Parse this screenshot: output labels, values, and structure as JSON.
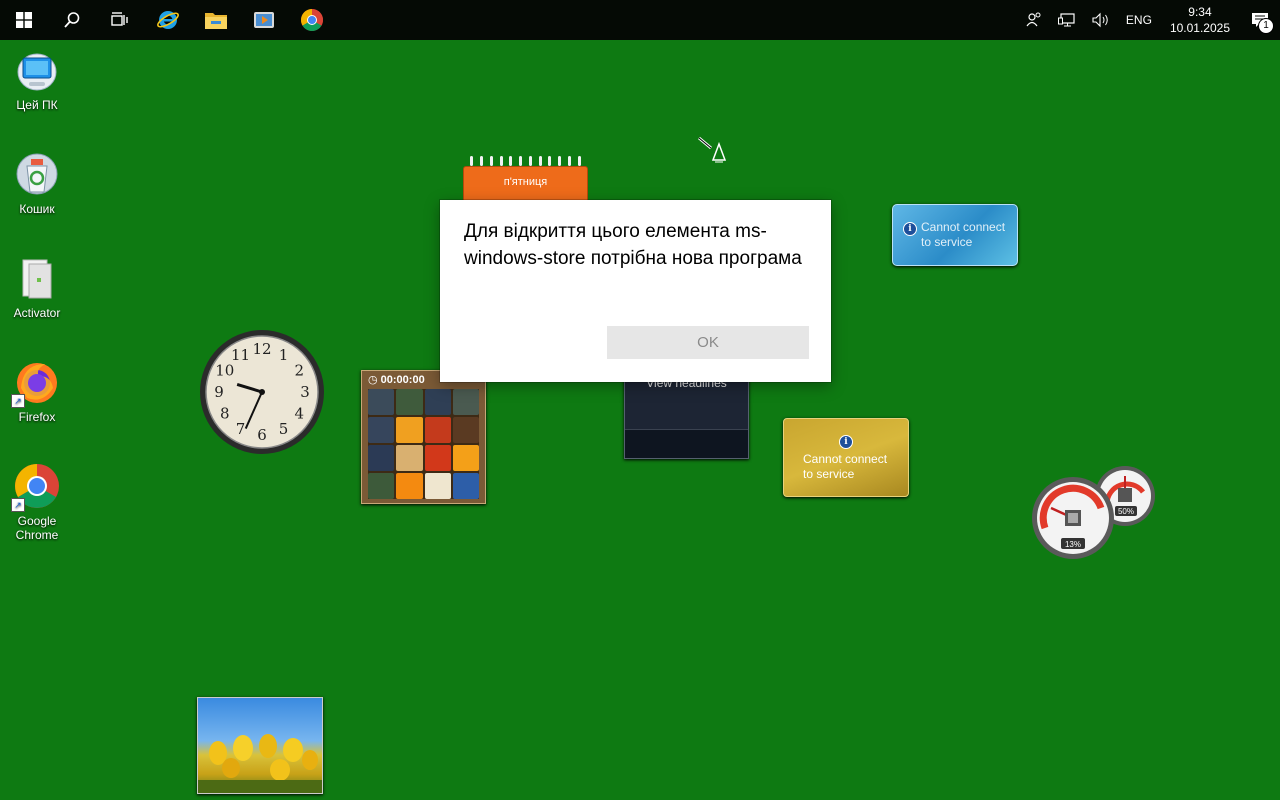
{
  "taskbar": {
    "buttons": [
      {
        "name": "start",
        "icon": "windows-logo-icon"
      },
      {
        "name": "search",
        "icon": "search-icon"
      },
      {
        "name": "task-view",
        "icon": "task-view-icon"
      },
      {
        "name": "internet-explorer",
        "icon": "internet-explorer-icon"
      },
      {
        "name": "file-explorer",
        "icon": "folder-icon"
      },
      {
        "name": "media-player",
        "icon": "media-player-icon"
      },
      {
        "name": "chrome",
        "icon": "chrome-icon"
      }
    ],
    "tray": {
      "language": "ENG",
      "time": "9:34",
      "date": "10.01.2025",
      "notification_count": "1"
    }
  },
  "desktop_icons": [
    {
      "label": "Цей ПК",
      "icon": "this-pc-icon"
    },
    {
      "label": "Кошик",
      "icon": "recycle-bin-icon"
    },
    {
      "label": "Activator",
      "icon": "activator-icon"
    },
    {
      "label": "Firefox",
      "icon": "firefox-icon"
    },
    {
      "label": "Google\nChrome",
      "icon": "chrome-icon"
    }
  ],
  "gadgets": {
    "calendar": {
      "day": "п'ятниця"
    },
    "weather": {
      "message": "Cannot connect to service"
    },
    "currency": {
      "message": "Cannot connect to service"
    },
    "headlines": {
      "label": "View headlines"
    },
    "puzzle": {
      "timer": "00:00:00"
    },
    "meters": {
      "cpu": "13%",
      "ram": "50%"
    },
    "clock": {
      "hour": 9,
      "minute": 34
    }
  },
  "dialog": {
    "message": "Для відкриття цього елемента ms-windows-store потрібна нова програма",
    "ok_label": "OK"
  },
  "colors": {
    "desktop_bg": "#0e7a12",
    "taskbar_bg": "#050a05",
    "calendar_accent": "#ee6b1a"
  }
}
